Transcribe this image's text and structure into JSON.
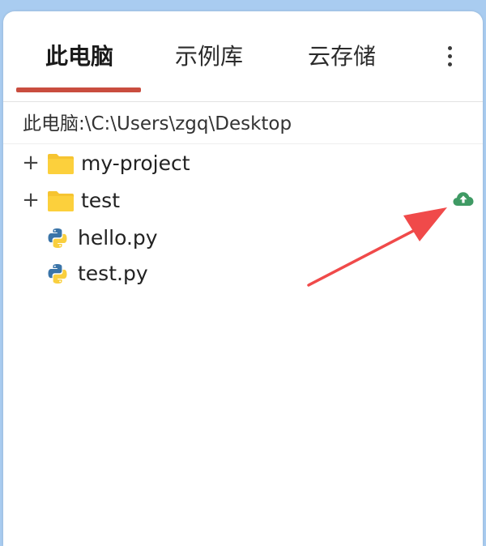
{
  "tabs": [
    {
      "label": "此电脑",
      "active": true
    },
    {
      "label": "示例库",
      "active": false
    },
    {
      "label": "云存储",
      "active": false
    }
  ],
  "accent_color": "#c94d3f",
  "more_menu_icon": "more-vertical-icon",
  "path": "此电脑:\\C:\\Users\\zgq\\Desktop",
  "tree": {
    "items": [
      {
        "type": "folder",
        "name": "my-project",
        "expander": "+"
      },
      {
        "type": "folder",
        "name": "test",
        "expander": "+"
      },
      {
        "type": "python-file",
        "name": "hello.py"
      },
      {
        "type": "python-file",
        "name": "test.py"
      }
    ]
  },
  "cloud_upload_icon": "cloud-upload-icon",
  "cloud_color": "#3f9a64",
  "annotation_arrow_color": "#f04a4a"
}
